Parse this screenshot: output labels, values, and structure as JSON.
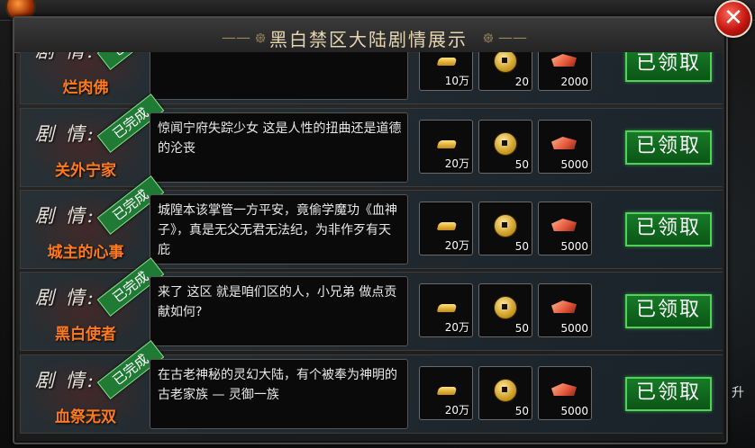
{
  "window": {
    "title": "黑白禁区大陆剧情展示",
    "title_ornament_left": "—— ᪥",
    "title_ornament_right": "᪥ ——",
    "close_symbol": "✕"
  },
  "section_label": "剧 情:",
  "badge_text": "已完成",
  "quests": [
    {
      "name": "烂肉佛",
      "description": "",
      "rewards": [
        {
          "icon": "gold-ingot-icon",
          "qty": "10万"
        },
        {
          "icon": "copper-coin-icon",
          "qty": "20"
        },
        {
          "icon": "material-icon",
          "qty": "2000"
        }
      ],
      "button": "已领取"
    },
    {
      "name": "关外宁家",
      "description": "惊闻宁府失踪少女 这是人性的扭曲还是道德的沦丧",
      "rewards": [
        {
          "icon": "gold-ingot-icon",
          "qty": "20万"
        },
        {
          "icon": "copper-coin-icon",
          "qty": "50"
        },
        {
          "icon": "material-icon",
          "qty": "5000"
        }
      ],
      "button": "已领取"
    },
    {
      "name": "城主的心事",
      "description": "城隍本该掌管一方平安，竟偷学魔功《血神子》，真是无父无君无法纪，为非作歹有天庇",
      "rewards": [
        {
          "icon": "gold-ingot-icon",
          "qty": "20万"
        },
        {
          "icon": "copper-coin-icon",
          "qty": "50"
        },
        {
          "icon": "material-icon",
          "qty": "5000"
        }
      ],
      "button": "已领取"
    },
    {
      "name": "黑白使者",
      "description": "来了 这区 就是咱们区的人，小兄弟 做点贡献如何?",
      "rewards": [
        {
          "icon": "gold-ingot-icon",
          "qty": "20万"
        },
        {
          "icon": "copper-coin-icon",
          "qty": "50"
        },
        {
          "icon": "material-icon",
          "qty": "5000"
        }
      ],
      "button": "已领取"
    },
    {
      "name": "血祭无双",
      "description": "在古老神秘的灵幻大陆，有个被奉为神明的古老家族 — 灵御一族",
      "rewards": [
        {
          "icon": "gold-ingot-icon",
          "qty": "20万"
        },
        {
          "icon": "copper-coin-icon",
          "qty": "50"
        },
        {
          "icon": "material-icon",
          "qty": "5000"
        }
      ],
      "button": "已领取"
    }
  ],
  "side_text": "升",
  "colors": {
    "quest_name": "#ff7a1f",
    "badge_green": "#1f7a34",
    "claim_green": "#52d05a",
    "close_red": "#c3160f"
  }
}
